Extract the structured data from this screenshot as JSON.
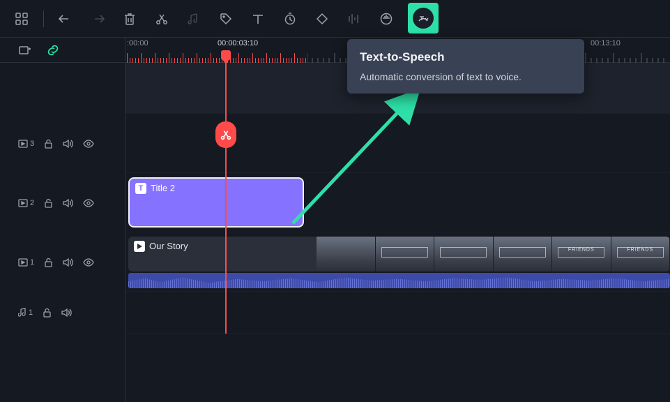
{
  "toolbar": {
    "icons": [
      "apps",
      "undo",
      "redo",
      "delete",
      "split",
      "audio-sync",
      "tag",
      "text",
      "timer",
      "mask",
      "bars",
      "audio-fx",
      "tts"
    ],
    "highlighted": "tts"
  },
  "tooltip": {
    "title": "Text-to-Speech",
    "body": "Automatic conversion of text to voice."
  },
  "ruler": {
    "times": [
      ":00:00",
      "00:00:03:10",
      "",
      "00:13:10"
    ],
    "playhead_time": "00:00:03:10"
  },
  "tracks": [
    {
      "id": 3,
      "kind": "video",
      "lock": true,
      "audio": true,
      "visible": true
    },
    {
      "id": 2,
      "kind": "video",
      "lock": true,
      "audio": true,
      "visible": true
    },
    {
      "id": 1,
      "kind": "video",
      "lock": true,
      "audio": true,
      "visible": true
    },
    {
      "id": 1,
      "kind": "audio",
      "lock": true,
      "audio": true,
      "visible": false
    }
  ],
  "clips": {
    "title": {
      "label": "Title 2"
    },
    "video": {
      "label": "Our Story",
      "thumb_labels": [
        "",
        "",
        "",
        "",
        "FRIENDS",
        "FRIENDS"
      ]
    }
  }
}
